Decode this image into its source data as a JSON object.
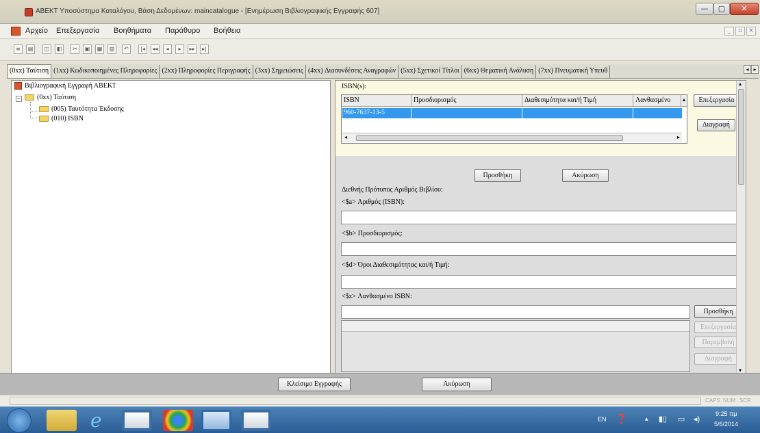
{
  "window": {
    "title": "ΑΒΕΚΤ Υποσύστημα Καταλόγου, Βάση Δεδομένων: maincatalogue - [Ενημέρωση Βιβλιογραφικής Εγγραφής 607]"
  },
  "menu": [
    "Αρχείο",
    "Επεξεργασία",
    "Βοηθήματα",
    "Παράθυρο",
    "Βοήθεια"
  ],
  "tabs": [
    "(0xx) Ταύτιση",
    "(1xx) Κωδικοποιημένες Πληροφορίες",
    "(2xx) Πληροφορίες Περιγραφής",
    "(3xx) Σημειώσεις",
    "(4xx) Διασυνδέσεις Αναγραφών",
    "(5xx) Σχετικοί Τίτλοι",
    "(6xx) Θεματική Ανάλυση",
    "(7xx) Πνευματική Υπευθ"
  ],
  "tree": {
    "root": "Βιβλιογραφική Εγγραφή ΑΒΕΚΤ",
    "node": "(0xx) Ταύτιση",
    "children": [
      "(005) Ταυτότητα Έκδοσης",
      "(010) ISBN"
    ]
  },
  "isbn": {
    "group_label": "ISBN(s):",
    "columns": [
      "ISBN",
      "Προσδιορισμός",
      "Διαθεσιμότητα και/ή Τιμή",
      "Λανθασμένο"
    ],
    "rows": [
      [
        "960-7637-13-5",
        "",
        "",
        ""
      ]
    ],
    "edit_button": "Επεξεργασία",
    "delete_button": "Διαγραφή"
  },
  "form": {
    "add_button": "Προσθήκη",
    "cancel_button": "Ακύρωση",
    "section_title": "Διεθνής Πρότυπος Αριθμός Βιβλίου:",
    "field_a": "<$a> Αριθμός (ISBN):",
    "field_b": "<$b> Προσδιορισμός:",
    "field_d": "<$d> Όροι Διαθεσιμότητας και/ή Τιμή:",
    "field_z": "<$z> Λανθασμένο ISBN:",
    "z_add_button": "Προσθήκη",
    "z_edit_button": "Επεξεργασία",
    "z_replace_button": "Παρεμβολή",
    "z_delete_button": "Διαγραφή"
  },
  "bottom": {
    "close_record": "Κλείσιμο Εγγραφής",
    "cancel": "Ακύρωση"
  },
  "status": {
    "indicators": [
      "CAPS",
      "NUM",
      "SCR"
    ]
  },
  "taskbar": {
    "lang": "EN",
    "time": "9:25 πμ",
    "date": "5/6/2014"
  }
}
